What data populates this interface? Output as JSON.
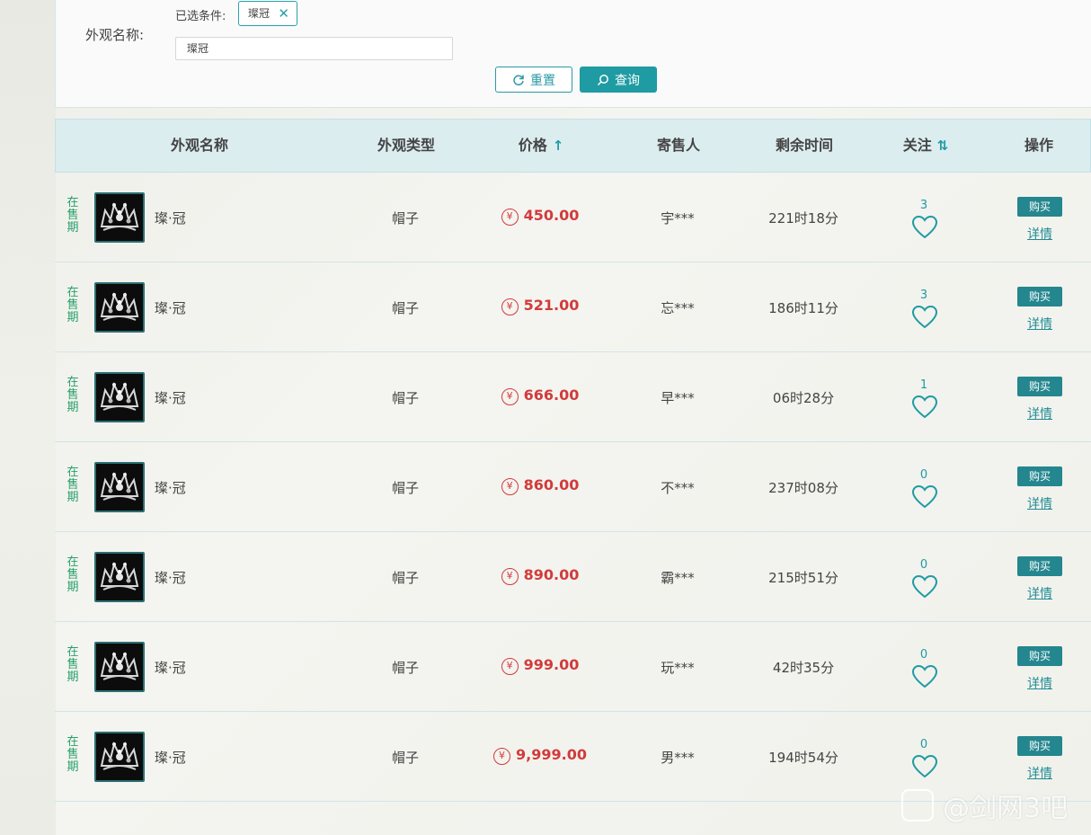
{
  "search": {
    "field_label": "外观名称:",
    "selected_label": "已选条件:",
    "selected_tag": "璨冠",
    "input_value": "璨冠",
    "reset_label": "重置",
    "query_label": "查询"
  },
  "table": {
    "headers": {
      "name": "外观名称",
      "type": "外观类型",
      "price": "价格",
      "seller": "寄售人",
      "time_left": "剩余时间",
      "follow": "关注",
      "action": "操作"
    },
    "rows": [
      {
        "status": "在售期",
        "name": "璨·冠",
        "type": "帽子",
        "price": "450.00",
        "seller": "宇***",
        "time_left": "221时18分",
        "follow_count": "3",
        "buy": "购买",
        "detail": "详情"
      },
      {
        "status": "在售期",
        "name": "璨·冠",
        "type": "帽子",
        "price": "521.00",
        "seller": "忘***",
        "time_left": "186时11分",
        "follow_count": "3",
        "buy": "购买",
        "detail": "详情"
      },
      {
        "status": "在售期",
        "name": "璨·冠",
        "type": "帽子",
        "price": "666.00",
        "seller": "早***",
        "time_left": "06时28分",
        "follow_count": "1",
        "buy": "购买",
        "detail": "详情"
      },
      {
        "status": "在售期",
        "name": "璨·冠",
        "type": "帽子",
        "price": "860.00",
        "seller": "不***",
        "time_left": "237时08分",
        "follow_count": "0",
        "buy": "购买",
        "detail": "详情"
      },
      {
        "status": "在售期",
        "name": "璨·冠",
        "type": "帽子",
        "price": "890.00",
        "seller": "霸***",
        "time_left": "215时51分",
        "follow_count": "0",
        "buy": "购买",
        "detail": "详情"
      },
      {
        "status": "在售期",
        "name": "璨·冠",
        "type": "帽子",
        "price": "999.00",
        "seller": "玩***",
        "time_left": "42时35分",
        "follow_count": "0",
        "buy": "购买",
        "detail": "详情"
      },
      {
        "status": "在售期",
        "name": "璨·冠",
        "type": "帽子",
        "price": "9,999.00",
        "seller": "男***",
        "time_left": "194时54分",
        "follow_count": "0",
        "buy": "购买",
        "detail": "详情"
      }
    ]
  },
  "watermark": "@剑网3吧",
  "colors": {
    "accent": "#1f9ba3",
    "price": "#d23b3b",
    "status": "#25a06a",
    "header_bg": "#dcedef"
  },
  "icons": {
    "reset": "refresh-icon",
    "query": "search-icon",
    "price_sort": "arrow-up-icon",
    "follow_sort": "sort-icon",
    "follow": "heart-icon",
    "currency": "yen-icon"
  }
}
